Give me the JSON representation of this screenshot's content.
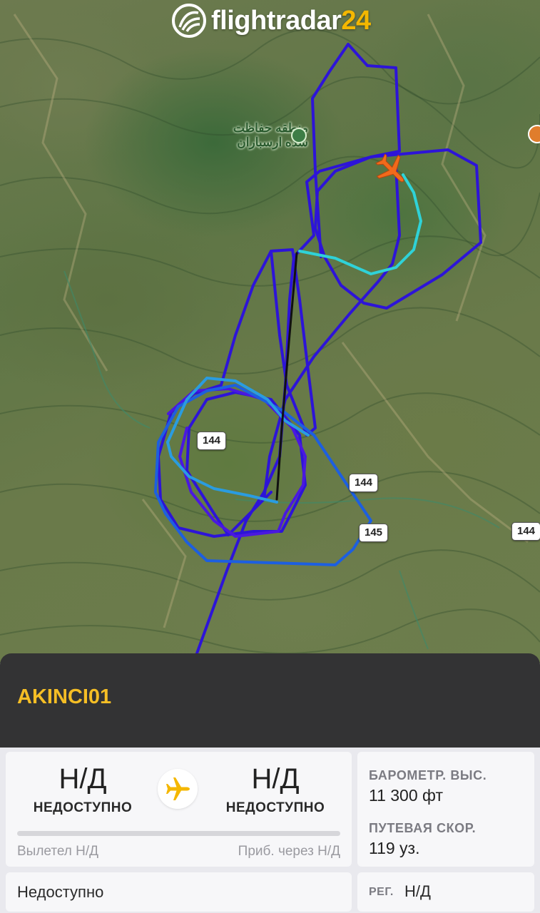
{
  "app": {
    "logo_text": "flightradar",
    "logo_number": "24"
  },
  "map": {
    "poi_label_line1": "منطقه حفاظت",
    "poi_label_line2": "شده ارسباران",
    "road_labels": [
      "144",
      "144",
      "145",
      "144"
    ],
    "track_colors": {
      "low": "#36e0d6",
      "mid": "#1f6fd6",
      "high": "#3a10d8"
    },
    "aircraft_color": "#f26a1b"
  },
  "flight": {
    "callsign": "AKINCI01",
    "origin_code": "Н/Д",
    "origin_name": "НЕДОСТУПНО",
    "destination_code": "Н/Д",
    "destination_name": "НЕДОСТУПНО",
    "departed_text": "Вылетел Н/Д",
    "arrival_text": "Приб. через Н/Д",
    "progress_fraction": 0,
    "baro_alt_label": "БАРОМЕТР. ВЫС.",
    "baro_alt_value": "11 300 фт",
    "ground_speed_label": "ПУТЕВАЯ СКОР.",
    "ground_speed_value": "119 уз.",
    "status_text": "Недоступно",
    "reg_label": "РЕГ.",
    "reg_value": "Н/Д"
  },
  "colors": {
    "accent": "#f5be25",
    "panel_dark": "#333334",
    "brand_yellow": "#f4b700"
  }
}
